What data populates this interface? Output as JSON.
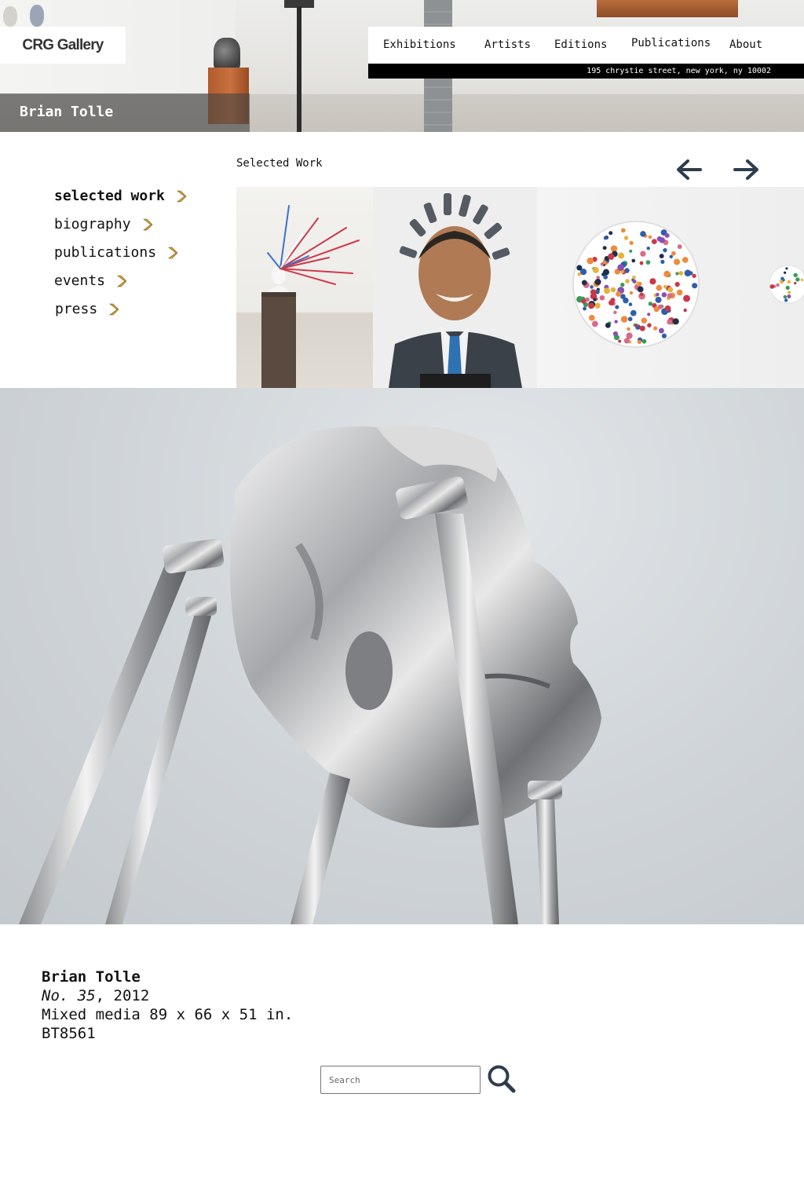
{
  "site": {
    "logo_text": "CRG Gallery",
    "address": "195 chrystie street, new york, ny 10002"
  },
  "nav": {
    "items": [
      {
        "label": "Exhibitions"
      },
      {
        "label": "Artists"
      },
      {
        "label": "Editions"
      },
      {
        "label": "Publications"
      },
      {
        "label": "About"
      }
    ]
  },
  "hero": {
    "artist_name": "Brian Tolle"
  },
  "side_menu": {
    "items": [
      {
        "label": "selected work",
        "active": true
      },
      {
        "label": "biography",
        "active": false
      },
      {
        "label": "publications",
        "active": false
      },
      {
        "label": "events",
        "active": false
      },
      {
        "label": "press",
        "active": false
      }
    ],
    "chevron_color": "#e0a82e"
  },
  "carousel": {
    "label": "Selected Work",
    "prev_icon": "arrow-left-icon",
    "next_icon": "arrow-right-icon",
    "arrow_color": "#2e3d4d"
  },
  "artwork": {
    "artist": "Brian Tolle",
    "title": "No. 35",
    "year": ", 2012",
    "details": "Mixed media 89 x 66 x 51 in.",
    "catalog_number": "BT8561"
  },
  "search": {
    "placeholder": "Search",
    "icon": "search-icon",
    "icon_color": "#2e3d4d"
  }
}
